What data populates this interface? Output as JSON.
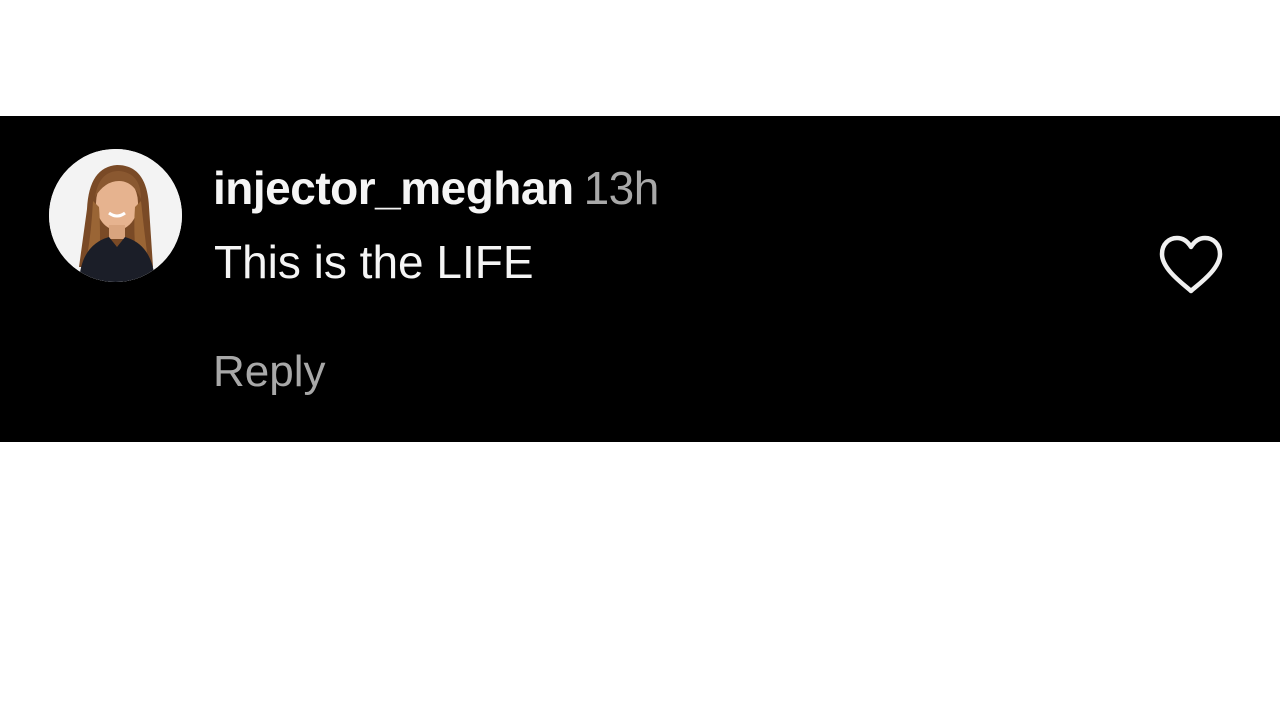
{
  "comment": {
    "username": "injector_meghan",
    "timestamp": "13h",
    "text": "This is the LIFE",
    "reply_label": "Reply",
    "like_icon": "heart-outline-icon",
    "avatar_alt": "profile-photo"
  },
  "colors": {
    "panel_background": "#000000",
    "primary_text": "#f5f5f5",
    "secondary_text": "#a8a8a8",
    "page_background": "#ffffff"
  }
}
